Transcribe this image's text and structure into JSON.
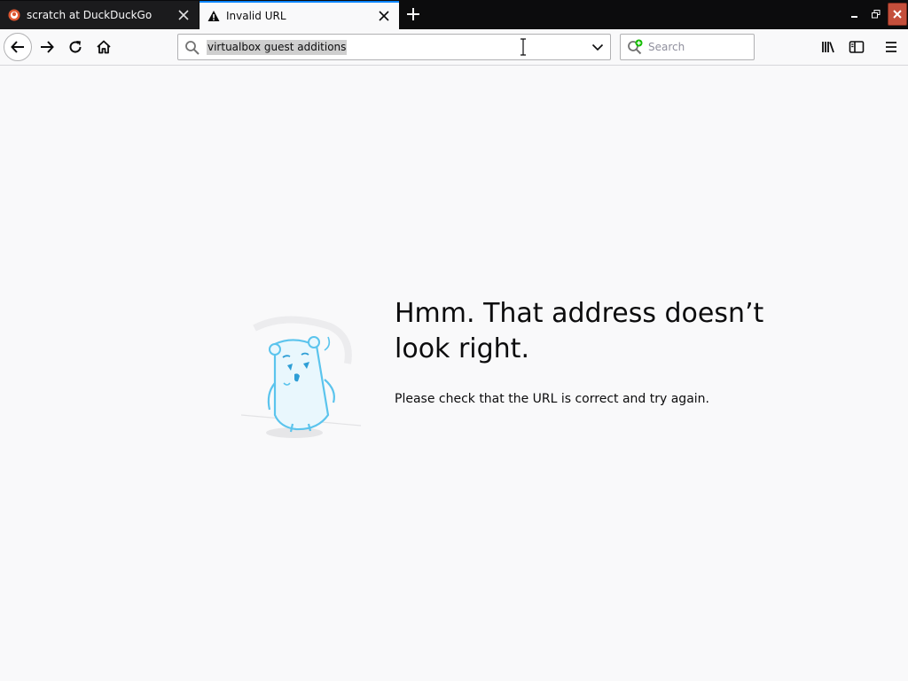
{
  "tabs": [
    {
      "title": "scratch at DuckDuckGo",
      "icon": "duckduckgo-icon",
      "active": false
    },
    {
      "title": "Invalid URL",
      "icon": "warning-icon",
      "active": true
    }
  ],
  "window_controls": {
    "minimize": "minimize-icon",
    "maximize": "restore-icon",
    "close": "close-icon"
  },
  "navbar": {
    "url_value": "virtualbox guest additions",
    "search_placeholder": "Search"
  },
  "error_page": {
    "title": "Hmm. That address doesn’t look right.",
    "message": "Please check that the URL is correct and try again."
  },
  "colors": {
    "accent": "#0a84ff",
    "close_button": "#c44f3b",
    "illustration": "#5bc4ed"
  }
}
